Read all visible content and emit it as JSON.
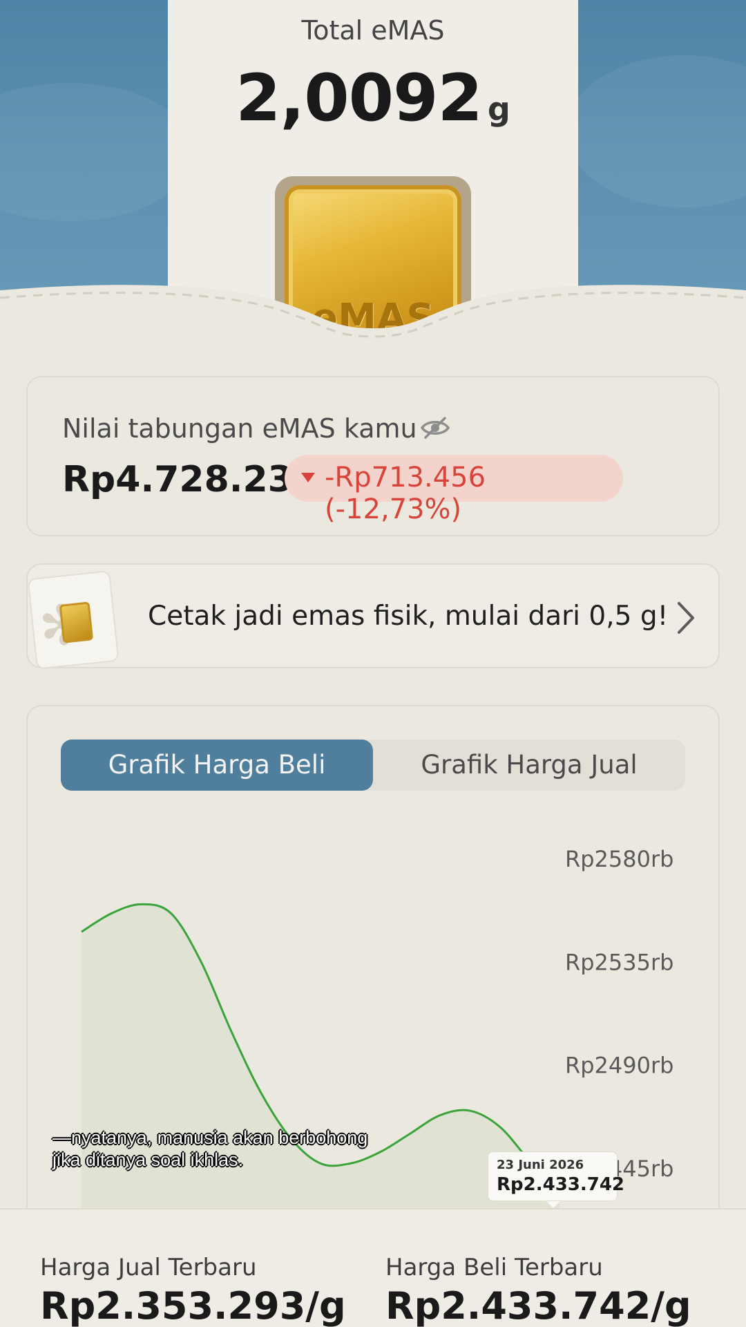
{
  "hero": {
    "title": "Total eMAS",
    "amount": "2,0092",
    "unit": "g",
    "bar_engraving": "eMAS"
  },
  "savings": {
    "label": "Nilai tabungan eMAS kamu",
    "amount": "Rp4.728.236",
    "change": "-Rp713.456 (-12,73%)",
    "change_color": "#d9443a",
    "visibility_icon": "eye-off-icon"
  },
  "print_banner": {
    "text": "Cetak jadi emas fisik, mulai dari 0,5 g!",
    "icon": "chevron-right-icon"
  },
  "chart_tabs": {
    "active": "Grafik Harga Beli",
    "inactive": "Grafik Harga Jual",
    "accent": "#4f7f9d"
  },
  "chart_data": {
    "type": "area",
    "y_tick_labels": [
      "Rp2580rb",
      "Rp2535rb",
      "Rp2490rb",
      "Rp2445rb"
    ],
    "y_ticks": [
      2580,
      2535,
      2490,
      2445
    ],
    "line_color": "#3aa33a",
    "fill_color": "#e0e2d4",
    "series": [
      {
        "points": [
          [
            0,
            2548
          ],
          [
            1,
            2556
          ],
          [
            2,
            2560
          ],
          [
            3,
            2556
          ],
          [
            4,
            2535
          ],
          [
            5,
            2505
          ],
          [
            6,
            2478
          ],
          [
            7,
            2458
          ],
          [
            8,
            2447
          ],
          [
            9,
            2447
          ],
          [
            10,
            2452
          ],
          [
            11,
            2460
          ],
          [
            12,
            2468
          ],
          [
            13,
            2470
          ],
          [
            14,
            2463
          ],
          [
            15,
            2448
          ],
          [
            16,
            2433.742
          ]
        ]
      }
    ],
    "tooltip": {
      "date": "23 Juni 2026",
      "value": "Rp2.433.742"
    }
  },
  "subtitle_overlay": {
    "line1": "—nyatanya, manusia akan berbohong",
    "line2": "jika ditanya soal ikhlas."
  },
  "latest_prices": {
    "sell_label": "Harga Jual Terbaru",
    "sell_value": "Rp2.353.293/g",
    "buy_label": "Harga Beli Terbaru",
    "buy_value": "Rp2.433.742/g"
  }
}
